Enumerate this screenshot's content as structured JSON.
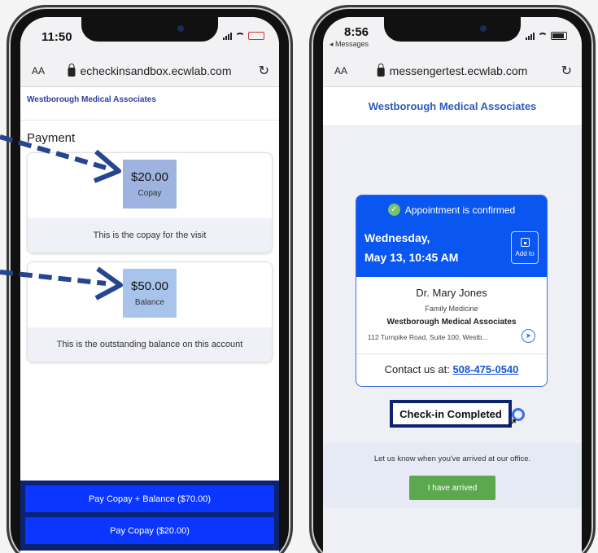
{
  "left_phone": {
    "status_time": "11:50",
    "url_aa": "AA",
    "url": "echeckinsandbox.ecwlab.com",
    "practice_name": "Westborough Medical Associates",
    "section_title": "Payment",
    "cards": [
      {
        "amount": "$20.00",
        "label": "Copay",
        "description": "This is the copay for the visit"
      },
      {
        "amount": "$50.00",
        "label": "Balance",
        "description": "This is the outstanding balance on this account"
      }
    ],
    "buttons": {
      "pay_both": "Pay Copay + Balance ($70.00)",
      "pay_copay": "Pay Copay ($20.00)"
    }
  },
  "right_phone": {
    "status_time": "8:56",
    "status_back": "◂ Messages",
    "url_aa": "AA",
    "url": "messengertest.ecwlab.com",
    "practice_name": "Westborough Medical Associates",
    "appointment": {
      "status": "Appointment is confirmed",
      "weekday": "Wednesday,",
      "date_time": "May 13, 10:45 AM",
      "add_to_label": "Add to",
      "doctor": "Dr. Mary Jones",
      "specialty": "Family Medicine",
      "practice": "Westborough Medical Associates",
      "address": "112 Turnpike Road, Suite 100, Westb...",
      "contact_label": "Contact us at:",
      "phone": "508-475-0540"
    },
    "checkin_status": "Check-in Completed",
    "arrived_prompt": "Let us know when you've arrived at our office.",
    "arrived_button": "I have arrived"
  },
  "colors": {
    "brand_blue": "#0a56f0",
    "pay_button": "#0a36ff",
    "footer_navy": "#0b2370",
    "arrived_green": "#5ca84e",
    "arrow_navy": "#26458f"
  },
  "icons": [
    "lock-icon",
    "reload-icon",
    "check-circle-icon",
    "calendar-add-icon",
    "navigate-icon",
    "refresh-icon",
    "cursor-icon",
    "arrow-icon"
  ]
}
